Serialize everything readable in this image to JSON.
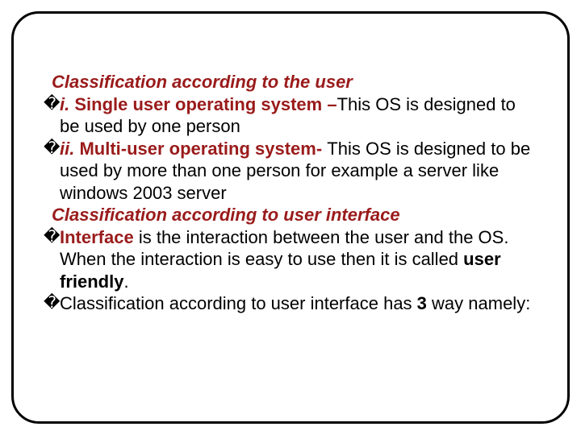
{
  "bullet_glyph": "�",
  "section1": {
    "heading": "Classification according to the user",
    "item1": {
      "lead": "i.",
      "title": " Single user operating system –",
      "text": "This OS is designed to be used by one person"
    },
    "item2": {
      "lead": "ii.",
      "title": " Multi-user operating system- ",
      "text": "This OS is designed to be used by more than one person for example a server like windows 2003 server"
    }
  },
  "section2": {
    "heading": "Classification according to user interface",
    "item1": {
      "lead": "Interface",
      "text_before": " is the interaction between the user and the OS. When the interaction is easy to use then it is called ",
      "bold_term": "user friendly",
      "text_after": "."
    },
    "item2": {
      "text_before": "Classification according to user interface has ",
      "bold_term": "3",
      "text_after": " way namely:"
    }
  }
}
